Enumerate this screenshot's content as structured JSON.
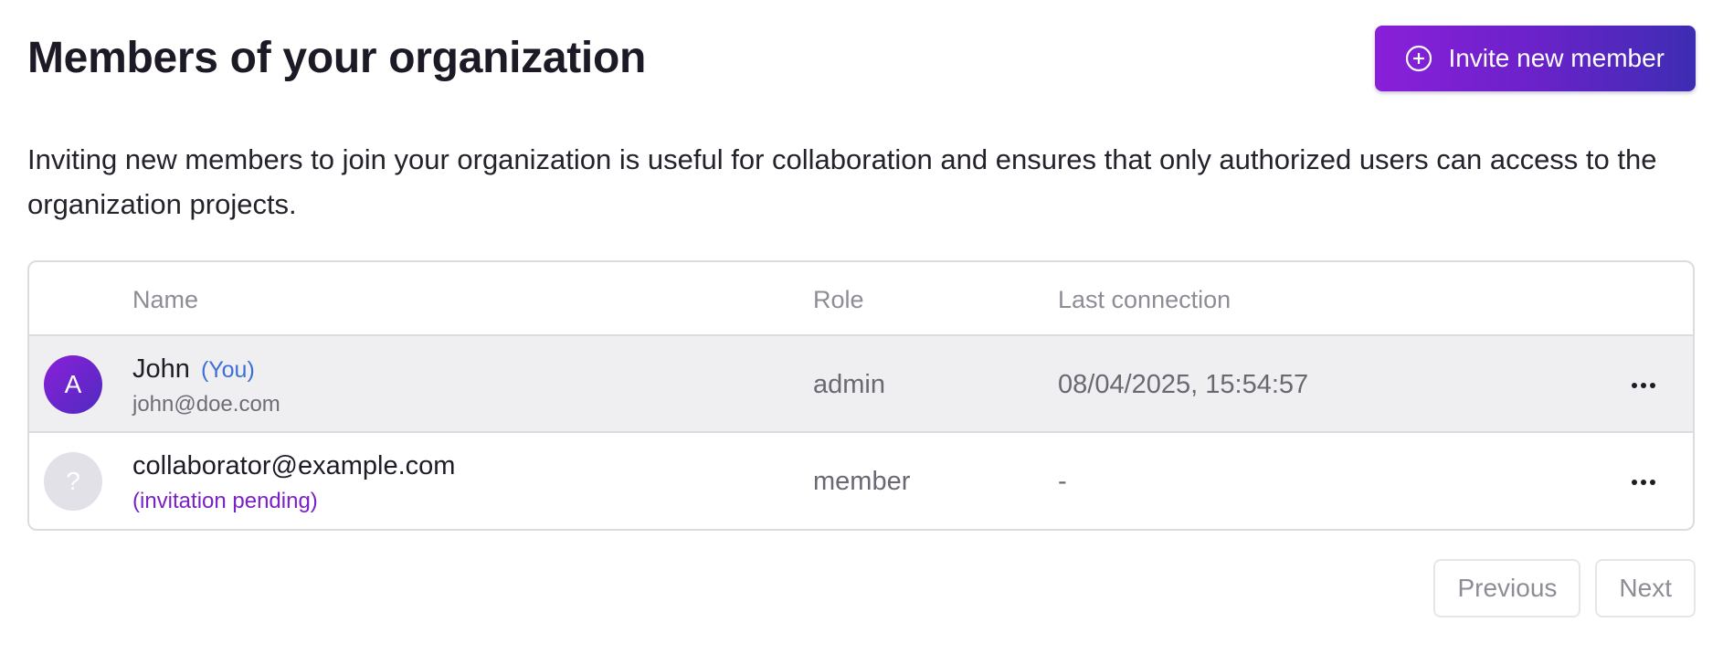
{
  "header": {
    "title": "Members of your organization",
    "invite_button": {
      "label": "Invite new member",
      "icon": "plus-circle-icon"
    }
  },
  "description": "Inviting new members to join your organization is useful for collaboration and ensures that only authorized users can access to the organization projects.",
  "table": {
    "columns": [
      "Name",
      "Role",
      "Last connection"
    ],
    "rows": [
      {
        "avatar": "A",
        "name": "John",
        "you_tag": "(You)",
        "email": "john@doe.com",
        "role": "admin",
        "last_connection": "08/04/2025, 15:54:57"
      },
      {
        "avatar": "?",
        "name": "collaborator@example.com",
        "status": "(invitation pending)",
        "role": "member",
        "last_connection": "-"
      }
    ]
  },
  "pagination": {
    "previous": "Previous",
    "next": "Next"
  },
  "colors": {
    "accent_start": "#8a1fd9",
    "accent_end": "#3d2db3",
    "you_tag": "#3d6fd6",
    "pending": "#7a1fc9"
  }
}
